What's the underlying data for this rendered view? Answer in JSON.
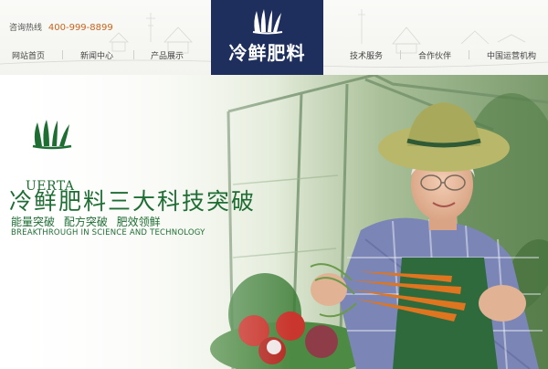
{
  "header": {
    "hotline_label": "咨询热线",
    "hotline_number": "400-999-8899",
    "logo_text": "冷鲜肥料",
    "nav_left": [
      "网站首页",
      "新闻中心",
      "产品展示"
    ],
    "nav_right": [
      "技术服务",
      "合作伙伴",
      "中国运营机构"
    ]
  },
  "banner": {
    "brand_name": "UERTA",
    "headline": "冷鲜肥料三大科技突破",
    "subline": "能量突破 配方突破 肥效领鲜",
    "english": "BREAKTHROUGH IN SCIENCE AND TECHNOLOGY"
  },
  "colors": {
    "logo_bg": "#1e2f5e",
    "brand_green": "#1e6e34",
    "hotline_orange": "#c8651e"
  },
  "icons": [
    "brand-logo-icon",
    "uerta-logo-icon"
  ]
}
